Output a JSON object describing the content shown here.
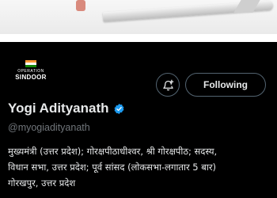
{
  "profile": {
    "name": "Yogi Adityanath",
    "handle": "@myogiadityanath",
    "bio_lines": [
      "मुख्यमंत्री (उत्तर प्रदेश); गोरक्षपीठाधीश्वर, श्री गोरक्षपीठ; सदस्य,",
      "विधान सभा, उत्तर प्रदेश; पूर्व सांसद (लोकसभा-लगातार 5 बार)",
      "गोरखपुर, उत्तर प्रदेश"
    ],
    "verified": true,
    "avatar": {
      "small_text": "OPERATION",
      "brand_text": "SINDOOR",
      "icon": "india-flag-icon"
    }
  },
  "actions": {
    "notify_icon": "bell-plus-icon",
    "follow_label": "Following"
  },
  "colors": {
    "background": "#000000",
    "verified_blue": "#1d9bf0",
    "text_primary": "#e7e9ea",
    "text_secondary": "#71767b",
    "button_border": "#536471"
  }
}
